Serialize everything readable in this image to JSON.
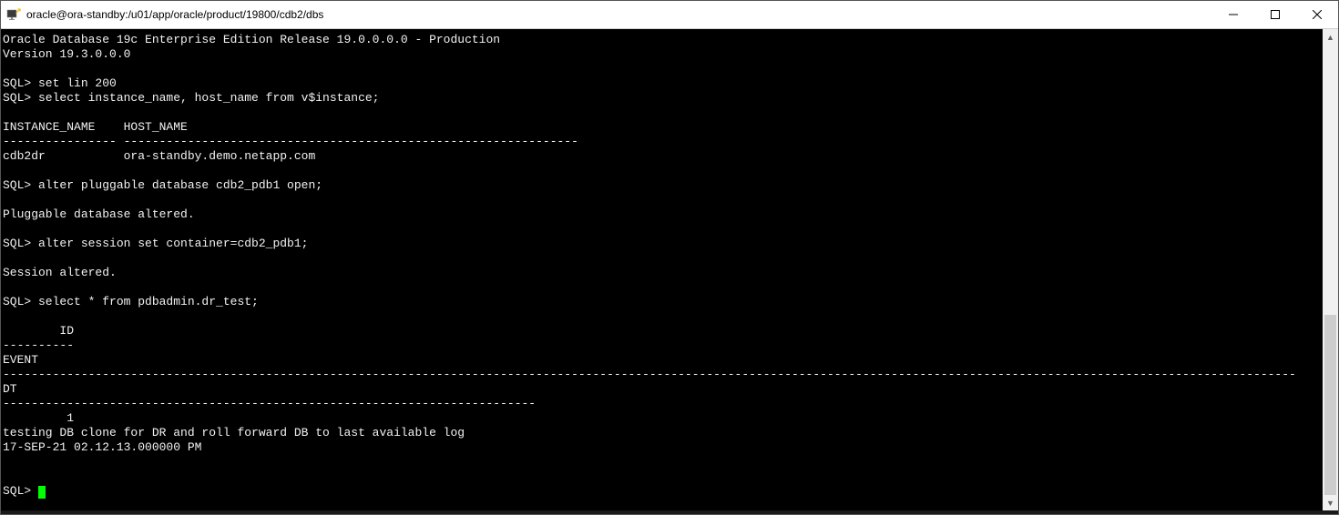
{
  "window": {
    "title": "oracle@ora-standby:/u01/app/oracle/product/19800/cdb2/dbs"
  },
  "terminal": {
    "lines": [
      "Oracle Database 19c Enterprise Edition Release 19.0.0.0.0 - Production",
      "Version 19.3.0.0.0",
      "",
      "SQL> set lin 200",
      "SQL> select instance_name, host_name from v$instance;",
      "",
      "INSTANCE_NAME    HOST_NAME",
      "---------------- ----------------------------------------------------------------",
      "cdb2dr           ora-standby.demo.netapp.com",
      "",
      "SQL> alter pluggable database cdb2_pdb1 open;",
      "",
      "Pluggable database altered.",
      "",
      "SQL> alter session set container=cdb2_pdb1;",
      "",
      "Session altered.",
      "",
      "SQL> select * from pdbadmin.dr_test;",
      "",
      "        ID",
      "----------",
      "EVENT",
      "--------------------------------------------------------------------------------------------------------------------------------------------------------------------------------------",
      "DT",
      "---------------------------------------------------------------------------",
      "         1",
      "testing DB clone for DR and roll forward DB to last available log",
      "17-SEP-21 02.12.13.000000 PM",
      "",
      "",
      "SQL> "
    ]
  },
  "scrollbar": {
    "thumb_top_pct": 60,
    "thumb_height_pct": 40
  }
}
